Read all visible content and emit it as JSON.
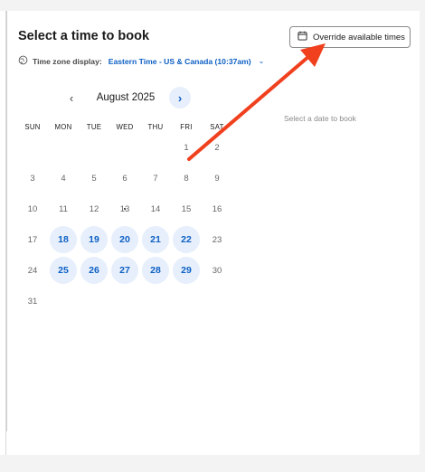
{
  "header": {
    "title": "Select a time to book",
    "override_button": "Override available times"
  },
  "timezone": {
    "label": "Time zone display:",
    "value": "Eastern Time - US & Canada (10:37am)"
  },
  "calendar": {
    "month_label": "August 2025",
    "weekdays": [
      "SUN",
      "MON",
      "TUE",
      "WED",
      "THU",
      "FRI",
      "SAT"
    ],
    "weeks": [
      [
        {
          "d": ""
        },
        {
          "d": ""
        },
        {
          "d": ""
        },
        {
          "d": ""
        },
        {
          "d": ""
        },
        {
          "d": "1"
        },
        {
          "d": "2"
        }
      ],
      [
        {
          "d": "3"
        },
        {
          "d": "4"
        },
        {
          "d": "5"
        },
        {
          "d": "6"
        },
        {
          "d": "7"
        },
        {
          "d": "8"
        },
        {
          "d": "9"
        }
      ],
      [
        {
          "d": "10"
        },
        {
          "d": "11"
        },
        {
          "d": "12"
        },
        {
          "d": "13",
          "today": true
        },
        {
          "d": "14"
        },
        {
          "d": "15"
        },
        {
          "d": "16"
        }
      ],
      [
        {
          "d": "17"
        },
        {
          "d": "18",
          "available": true
        },
        {
          "d": "19",
          "available": true
        },
        {
          "d": "20",
          "available": true
        },
        {
          "d": "21",
          "available": true
        },
        {
          "d": "22",
          "available": true
        },
        {
          "d": "23"
        }
      ],
      [
        {
          "d": "24"
        },
        {
          "d": "25",
          "available": true
        },
        {
          "d": "26",
          "available": true
        },
        {
          "d": "27",
          "available": true
        },
        {
          "d": "28",
          "available": true
        },
        {
          "d": "29",
          "available": true
        },
        {
          "d": "30"
        }
      ],
      [
        {
          "d": "31"
        },
        {
          "d": ""
        },
        {
          "d": ""
        },
        {
          "d": ""
        },
        {
          "d": ""
        },
        {
          "d": ""
        },
        {
          "d": ""
        }
      ]
    ]
  },
  "slots": {
    "empty_message": "Select a date to book"
  },
  "colors": {
    "accent": "#0d5fc4",
    "available_bg": "#e6effb",
    "annotation_arrow": "#f0401e"
  },
  "icons": {
    "override": "calendar-icon",
    "timezone": "globe-icon",
    "prev": "chevron-left-icon",
    "next": "chevron-right-icon"
  }
}
